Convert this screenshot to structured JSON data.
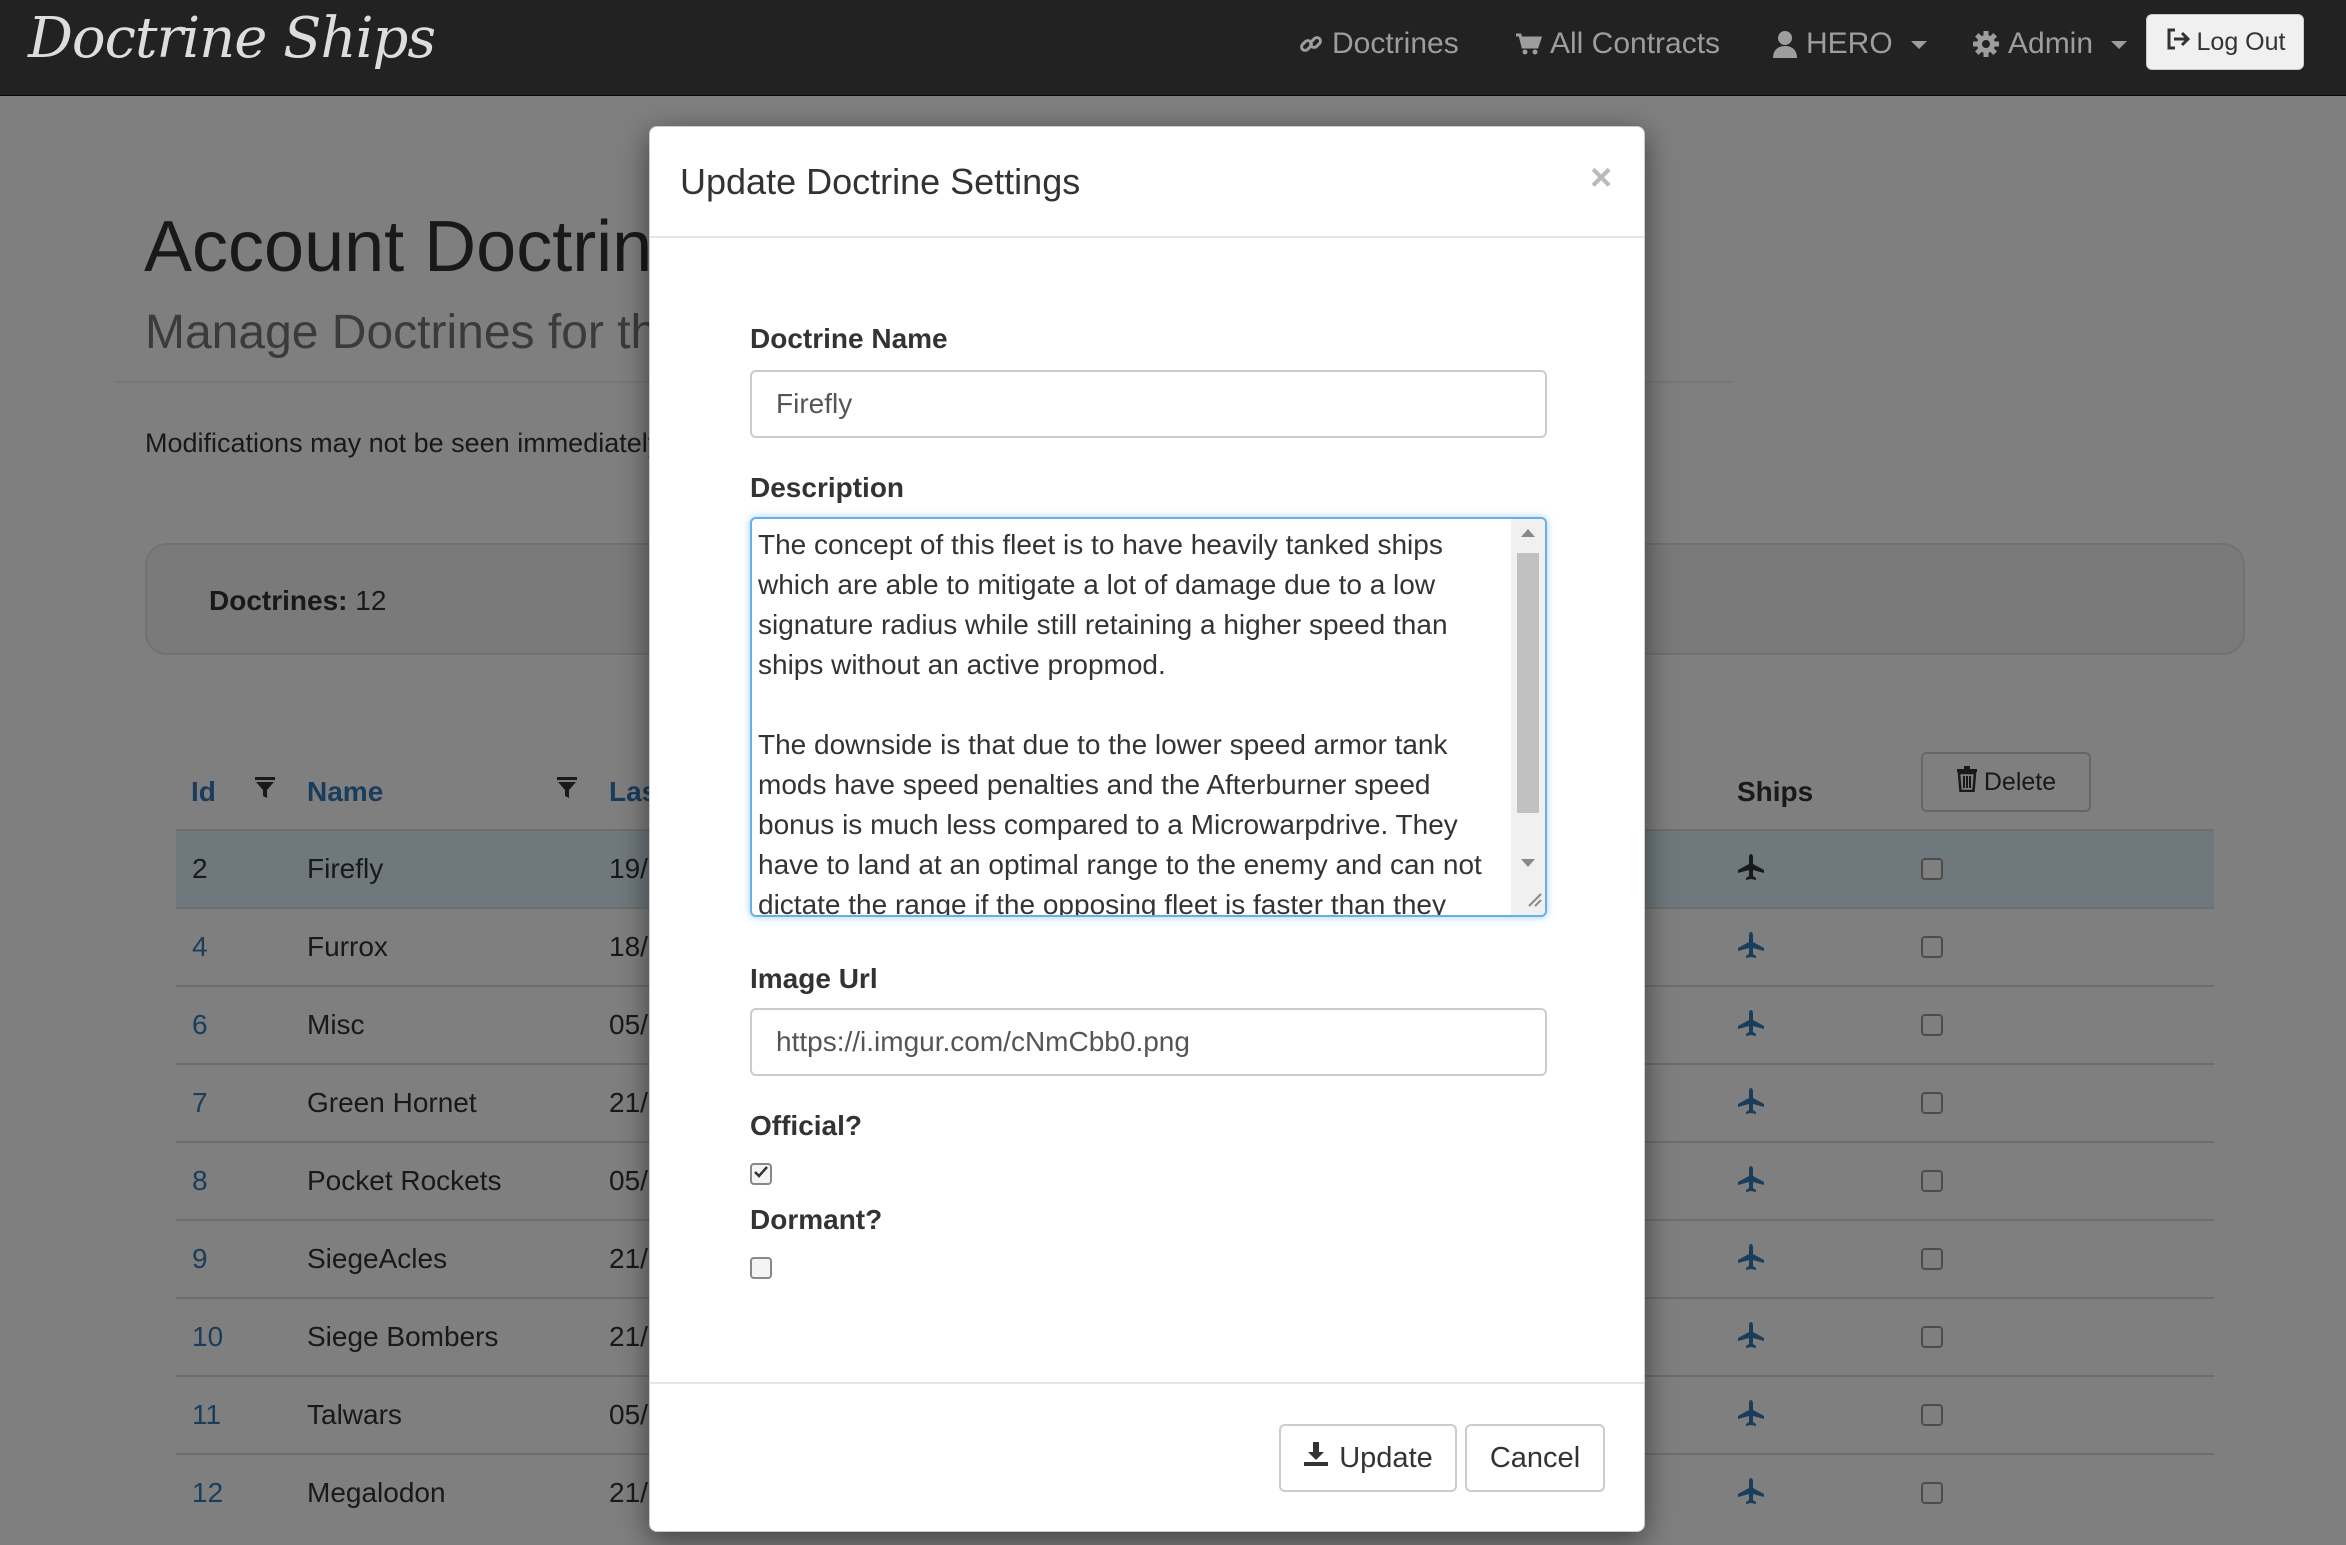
{
  "navbar": {
    "brand": "Doctrine Ships",
    "doctrines": "Doctrines",
    "all_contracts": "All Contracts",
    "user": "HERO",
    "admin": "Admin",
    "logout": "Log Out"
  },
  "page": {
    "title": "Account Doctrines",
    "subtitle": "Manage Doctrines for the",
    "note": "Modifications may not be seen immediately",
    "summary_label": "Doctrines:",
    "summary_count": "12"
  },
  "table": {
    "headers": {
      "id": "Id",
      "name": "Name",
      "last": "Last",
      "ships": "Ships"
    },
    "delete_label": "Delete",
    "rows": [
      {
        "id": "2",
        "name": "Firefly",
        "date": "19/"
      },
      {
        "id": "4",
        "name": "Furrox",
        "date": "18/"
      },
      {
        "id": "6",
        "name": "Misc",
        "date": "05/"
      },
      {
        "id": "7",
        "name": "Green Hornet",
        "date": "21/"
      },
      {
        "id": "8",
        "name": "Pocket Rockets",
        "date": "05/"
      },
      {
        "id": "9",
        "name": "SiegeAcles",
        "date": "21/"
      },
      {
        "id": "10",
        "name": "Siege Bombers",
        "date": "21/"
      },
      {
        "id": "11",
        "name": "Talwars",
        "date": "05/"
      },
      {
        "id": "12",
        "name": "Megalodon",
        "date": "21/"
      }
    ]
  },
  "modal": {
    "title": "Update Doctrine Settings",
    "close": "×",
    "name_label": "Doctrine Name",
    "name_value": "Firefly",
    "description_label": "Description",
    "description_value": "The concept of this fleet is to have heavily tanked ships which are able to mitigate a lot of damage due to a low signature radius while still retaining a higher speed than ships without an active propmod.\n\nThe downside is that due to the lower speed armor tank mods have speed penalties and the Afterburner speed bonus is much less compared to a Microwarpdrive. They have to land at an optimal range to the enemy and can not dictate the range if the opposing fleet is faster than they",
    "image_url_label": "Image Url",
    "image_url_value": "https://i.imgur.com/cNmCbb0.png",
    "official_label": "Official?",
    "official_checked": true,
    "dormant_label": "Dormant?",
    "dormant_checked": false,
    "update_button": "Update",
    "cancel_button": "Cancel"
  },
  "colors": {
    "navbar_bg": "#222222",
    "link_blue": "#337ab7",
    "active_row": "#dff0f8",
    "focus_border": "#66afe9"
  }
}
